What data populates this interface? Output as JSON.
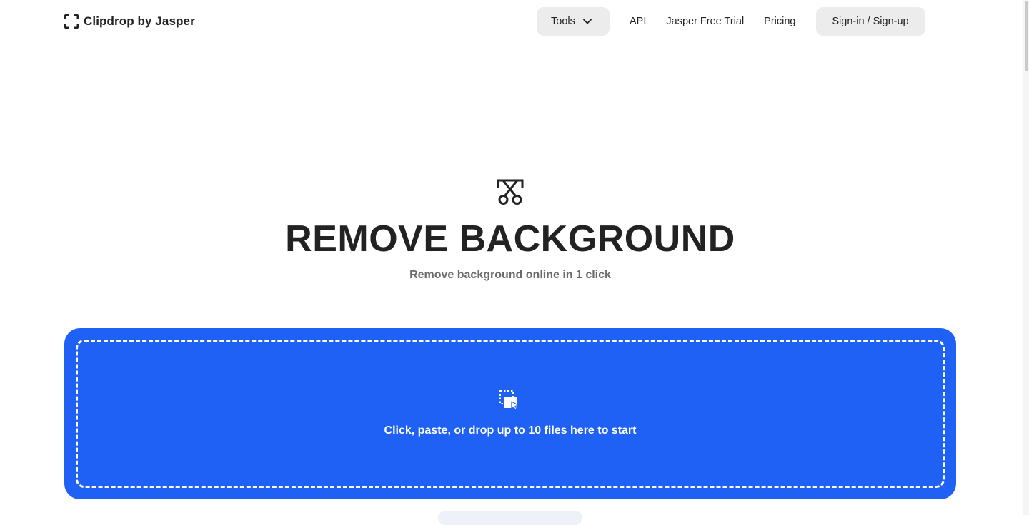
{
  "header": {
    "logo_text": "Clipdrop by Jasper",
    "nav": {
      "tools_label": "Tools",
      "api_label": "API",
      "trial_label": "Jasper Free Trial",
      "pricing_label": "Pricing",
      "signin_label": "Sign-in / Sign-up"
    }
  },
  "hero": {
    "icon": "scissors-icon",
    "title": "REMOVE BACKGROUND",
    "subtitle": "Remove background online in 1 click"
  },
  "dropzone": {
    "icon": "upload-cursor-icon",
    "text": "Click, paste, or drop up to 10 files here to start"
  },
  "colors": {
    "accent": "#1f61f4",
    "nav_button_bg": "#ececec",
    "text_dark": "#222222",
    "text_muted": "#6b6b6b"
  }
}
